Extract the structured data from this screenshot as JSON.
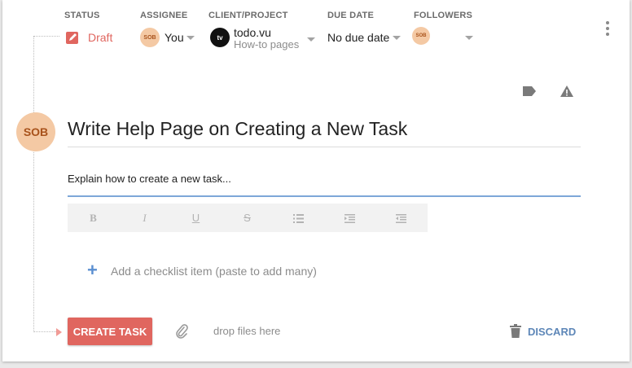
{
  "meta": {
    "status_label": "STATUS",
    "assignee_label": "ASSIGNEE",
    "client_label": "CLIENT/PROJECT",
    "due_label": "DUE DATE",
    "followers_label": "FOLLOWERS",
    "status_value": "Draft",
    "assignee_initials": "SOB",
    "assignee_value": "You",
    "client_logo": "tv",
    "client_value": "todo.vu",
    "project_value": "How-to pages",
    "due_value": "No due date",
    "follower_initials": "SOB"
  },
  "task": {
    "creator_initials": "SOB",
    "title": "Write Help Page on Creating a New Task",
    "description": "Explain how to create a new task..."
  },
  "toolbar": {
    "bold": "B",
    "italic": "I",
    "underline": "U",
    "strike": "S"
  },
  "checklist": {
    "plus": "+",
    "placeholder": "Add a checklist item (paste to add many)"
  },
  "footer": {
    "create_label": "CREATE TASK",
    "drop_label": "drop files here",
    "discard_label": "DISCARD"
  },
  "colors": {
    "accent_red": "#e0665f",
    "link_blue": "#5e87b8",
    "avatar_bg": "#f4c9a4"
  },
  "icons": [
    "edit-icon",
    "chevron-down-icon",
    "more-vertical-icon",
    "tag-icon",
    "warning-icon",
    "bullet-list-icon",
    "indent-icon",
    "outdent-icon",
    "plus-icon",
    "paperclip-icon",
    "trash-icon"
  ]
}
